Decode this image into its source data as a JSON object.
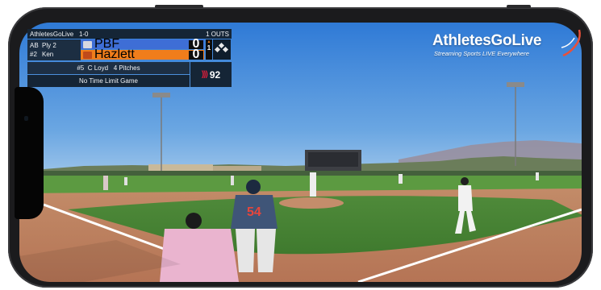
{
  "scoreboard": {
    "title": "AthletesGoLive",
    "series": "1-0",
    "outs": "1 OUTS",
    "at_bat": [
      {
        "label": "AB",
        "value": "Ply 2"
      },
      {
        "label": "#2",
        "value": "Ken"
      }
    ],
    "teams": [
      {
        "name": "PBF",
        "score": "0",
        "color": "#3e6ed6"
      },
      {
        "name": "Hazlett",
        "score": "0",
        "color": "#f07d1b"
      }
    ],
    "inning": "1",
    "pitcher": "#5  C Loyd   4 Pitches",
    "time_limit": "No Time Limit Game",
    "pitch_speed": "92"
  },
  "brand": {
    "name": "AthletesGoLive",
    "tagline": "Streaming Sports LIVE Everywhere"
  },
  "colors": {
    "scoreboard_bg": "#152536",
    "home_team": "#3e6ed6",
    "away_team": "#f07d1b",
    "speed_accent": "#e11d3a"
  }
}
